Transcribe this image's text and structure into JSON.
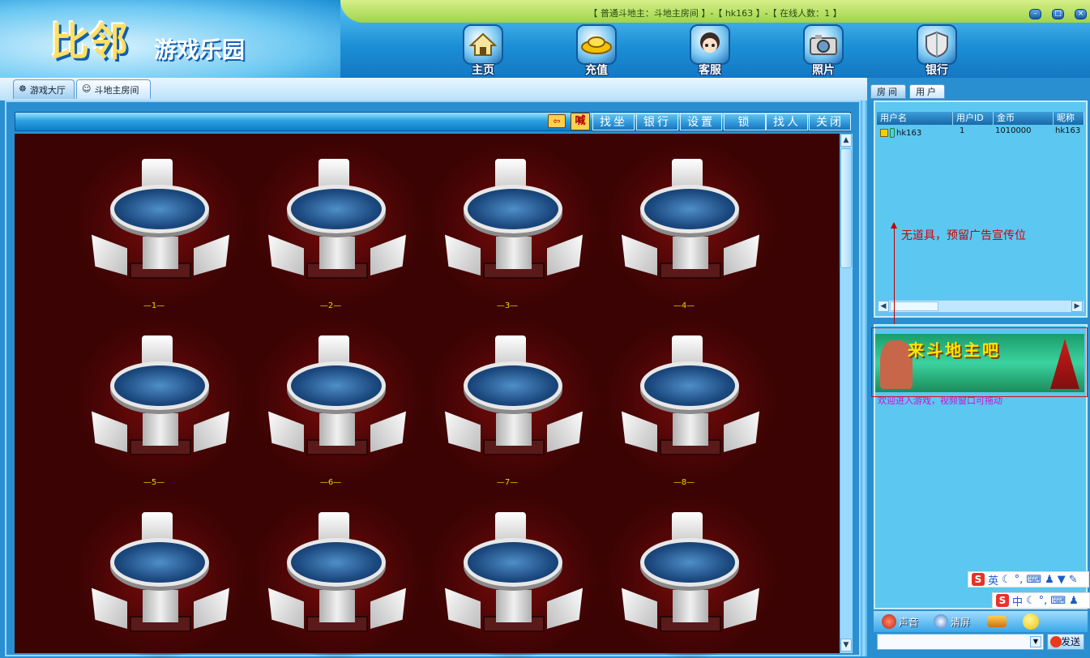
{
  "app": {
    "logo_main": "比邻",
    "logo_sub": "游戏乐园",
    "status_line": "【 普通斗地主：斗地主房间 】-【 hk163 】-【 在线人数：1 】",
    "window_buttons": [
      "minimize",
      "maximize",
      "close"
    ]
  },
  "nav": {
    "items": [
      {
        "label": "主页",
        "icon": "home-icon"
      },
      {
        "label": "充值",
        "icon": "gold-ingot-icon"
      },
      {
        "label": "客服",
        "icon": "service-girl-icon"
      },
      {
        "label": "照片",
        "icon": "camera-icon"
      },
      {
        "label": "银行",
        "icon": "shield-icon"
      }
    ]
  },
  "tabs": [
    {
      "label": "游戏大厅",
      "icon": "lobby-icon"
    },
    {
      "label": "斗地主房间",
      "icon": "room-icon"
    }
  ],
  "toolbar": {
    "buttons": [
      "找坐",
      "银行",
      "设置",
      "锁",
      "找人",
      "关闭"
    ],
    "icons": [
      "exit-door-icon",
      "shout-icon"
    ],
    "shout_label": "喊"
  },
  "tables": [
    {
      "number": "—1—"
    },
    {
      "number": "—2—"
    },
    {
      "number": "—3—"
    },
    {
      "number": "—4—"
    },
    {
      "number": "—5—"
    },
    {
      "number": "—6—"
    },
    {
      "number": "—7—"
    },
    {
      "number": "—8—"
    },
    {
      "number": ""
    },
    {
      "number": ""
    },
    {
      "number": ""
    },
    {
      "number": ""
    }
  ],
  "right": {
    "tabs": [
      "房间",
      "用户"
    ],
    "columns": [
      "用户名",
      "用户ID",
      "金币",
      "昵称"
    ],
    "users": [
      {
        "username": "hk163",
        "user_id": "1",
        "gold": "1010000",
        "nickname": "hk163"
      }
    ],
    "ad_note": "无道具，预留广告宣传位",
    "ad_banner_text": "来斗地主吧",
    "welcome": "欢迎进入游戏，视频窗口可拖动",
    "ime_en": "英",
    "ime_zh": "中",
    "ime_logo": "S",
    "bottom_buttons": [
      {
        "label": "声音",
        "icon": "sound-icon"
      },
      {
        "label": "清屏",
        "icon": "clear-screen-icon"
      },
      {
        "label": "",
        "icon": "pen-icon"
      },
      {
        "label": "",
        "icon": "smiley-icon"
      }
    ],
    "send_label": "发送"
  },
  "colors": {
    "accent": "#1b8fd6",
    "table_bg": "#3b0303",
    "number_yellow": "#f2d800",
    "note_red": "#d40000",
    "welcome_magenta": "#d010d0"
  }
}
